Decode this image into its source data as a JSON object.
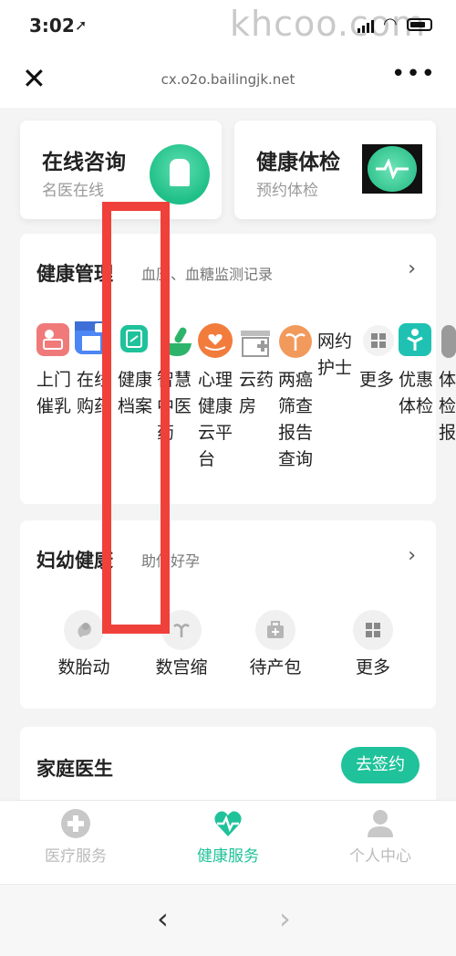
{
  "status_bar": {
    "time": "3:02",
    "watermark": "khcoo.com"
  },
  "browser_bar": {
    "url": "cx.o2o.bailingjk.net"
  },
  "top_cards": [
    {
      "title": "在线咨询",
      "subtitle": "名医在线",
      "icon": "doctor-icon"
    },
    {
      "title": "健康体检",
      "subtitle": "预约体检",
      "icon": "heartbeat-icon"
    }
  ],
  "health_mgmt": {
    "title": "健康管理",
    "subtitle": "血压、血糖监测记录",
    "items": [
      {
        "label": "上门催乳",
        "icon": "nursing-icon",
        "color": "#f07a7a"
      },
      {
        "label": "在线购药",
        "icon": "pharmacy-store-icon",
        "color": "#4d86f5"
      },
      {
        "label": "健康档案",
        "icon": "health-record-icon",
        "color": "#1fc29a"
      },
      {
        "label": "智慧中医药",
        "icon": "mortar-icon",
        "color": "#2db46b"
      },
      {
        "label": "心理健康云平台",
        "icon": "heart-hand-icon",
        "color": "#f27c3c"
      },
      {
        "label": "云药房",
        "icon": "cloud-pharmacy-icon",
        "color": "#9a9a9a"
      },
      {
        "label": "两癌筛查报告查询",
        "icon": "uterus-icon",
        "color": "#f29a5c"
      },
      {
        "label": "网约护士",
        "icon": "",
        "color": ""
      },
      {
        "label": "更多",
        "icon": "grid-more-icon",
        "color": "#c9c9c9"
      },
      {
        "label": "优惠体检",
        "icon": "checkup-icon",
        "color": "#1fc2b2"
      },
      {
        "label": "体检报",
        "icon": "report-icon",
        "color": "#9a9a9a"
      }
    ]
  },
  "maternal": {
    "title": "妇幼健康",
    "subtitle": "助你好孕",
    "items": [
      {
        "label": "数胎动",
        "icon": "fetus-icon"
      },
      {
        "label": "数宫缩",
        "icon": "contraction-icon"
      },
      {
        "label": "待产包",
        "icon": "bag-icon"
      },
      {
        "label": "更多",
        "icon": "grid-more-icon"
      }
    ]
  },
  "family_doctor": {
    "title": "家庭医生",
    "button": "去签约"
  },
  "tabs": [
    {
      "label": "医疗服务",
      "icon": "medical-cross-icon",
      "active": false
    },
    {
      "label": "健康服务",
      "icon": "heart-pulse-icon",
      "active": true
    },
    {
      "label": "个人中心",
      "icon": "person-icon",
      "active": false
    }
  ],
  "colors": {
    "accent": "#1fc29a",
    "highlight_box": "#f0403a",
    "inactive": "#bbbbbb"
  }
}
